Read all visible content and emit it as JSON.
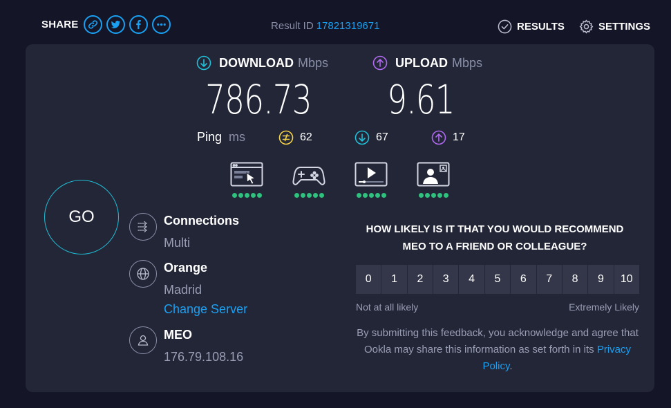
{
  "header": {
    "share_label": "SHARE",
    "share_buttons": [
      "link-icon",
      "twitter-icon",
      "facebook-icon",
      "more-icon"
    ],
    "result_id_label": "Result ID",
    "result_id": "17821319671",
    "results_label": "RESULTS",
    "settings_label": "SETTINGS"
  },
  "download": {
    "label": "DOWNLOAD",
    "unit": "Mbps",
    "value": "786.73"
  },
  "upload": {
    "label": "UPLOAD",
    "unit": "Mbps",
    "value": "9.61"
  },
  "ping": {
    "label": "Ping",
    "unit": "ms",
    "idle": "62",
    "download": "67",
    "upload": "17"
  },
  "use_cases": [
    {
      "icon": "web-browsing-icon",
      "rating": 5
    },
    {
      "icon": "gaming-icon",
      "rating": 5
    },
    {
      "icon": "video-streaming-icon",
      "rating": 5
    },
    {
      "icon": "video-chat-icon",
      "rating": 5
    }
  ],
  "go_label": "GO",
  "connections": {
    "title": "Connections",
    "value": "Multi"
  },
  "server": {
    "name": "Orange",
    "location": "Madrid",
    "change_label": "Change Server"
  },
  "provider": {
    "name": "MEO",
    "ip": "176.79.108.16"
  },
  "survey": {
    "question": "HOW LIKELY IS IT THAT YOU WOULD RECOMMEND MEO TO A FRIEND OR COLLEAGUE?",
    "scale": [
      "0",
      "1",
      "2",
      "3",
      "4",
      "5",
      "6",
      "7",
      "8",
      "9",
      "10"
    ],
    "low_label": "Not at all likely",
    "high_label": "Extremely Likely",
    "disclaimer": "By submitting this feedback, you acknowledge and agree that Ookla may share this information as set forth in its",
    "privacy_label": "Privacy Policy",
    "period": "."
  },
  "colors": {
    "accent": "#1aa0f2",
    "download": "#20c0d8",
    "upload": "#b06af0",
    "ping": "#f5d547",
    "rating": "#2ec27e"
  }
}
